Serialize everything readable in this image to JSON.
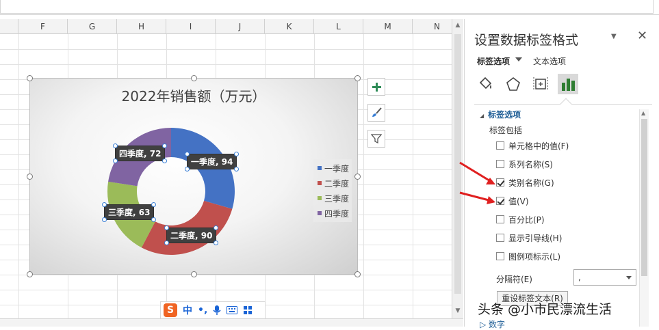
{
  "sheet": {
    "columns": [
      "F",
      "G",
      "H",
      "I",
      "J",
      "K",
      "L",
      "M",
      "N"
    ]
  },
  "chart": {
    "title": "2022年销售额（万元）",
    "legend": [
      "一季度",
      "二季度",
      "三季度",
      "四季度"
    ],
    "labels": {
      "q1": "一季度, 94",
      "q2": "二季度, 90",
      "q3": "三季度, 63",
      "q4": "四季度, 72"
    },
    "colors": [
      "#4472c4",
      "#c0504d",
      "#9bbb59",
      "#8064a2"
    ]
  },
  "chart_data": {
    "type": "pie",
    "subtype": "doughnut",
    "title": "2022年销售额（万元）",
    "categories": [
      "一季度",
      "二季度",
      "三季度",
      "四季度"
    ],
    "values": [
      94,
      90,
      63,
      72
    ],
    "legend_position": "right"
  },
  "chart_buttons": {
    "add": "chart-elements-icon",
    "style": "chart-styles-icon",
    "filter": "chart-filters-icon"
  },
  "ime": {
    "mode": "中",
    "punct": "•,"
  },
  "pane": {
    "title": "设置数据标签格式",
    "tab_label_options": "标签选项",
    "tab_text_options": "文本选项",
    "section": "标签选项",
    "sub_head": "标签包括",
    "options": [
      {
        "label": "单元格中的值(F)",
        "checked": false
      },
      {
        "label": "系列名称(S)",
        "checked": false
      },
      {
        "label": "类别名称(G)",
        "checked": true
      },
      {
        "label": "值(V)",
        "checked": true
      },
      {
        "label": "百分比(P)",
        "checked": false
      },
      {
        "label": "显示引导线(H)",
        "checked": false
      },
      {
        "label": "图例项标示(L)",
        "checked": false
      }
    ],
    "separator_label": "分隔符(E)",
    "separator_value": ",",
    "reset_label": "重设标签文本(R)",
    "next_section": "数字"
  },
  "watermark": "头条 @小市民漂流生活"
}
